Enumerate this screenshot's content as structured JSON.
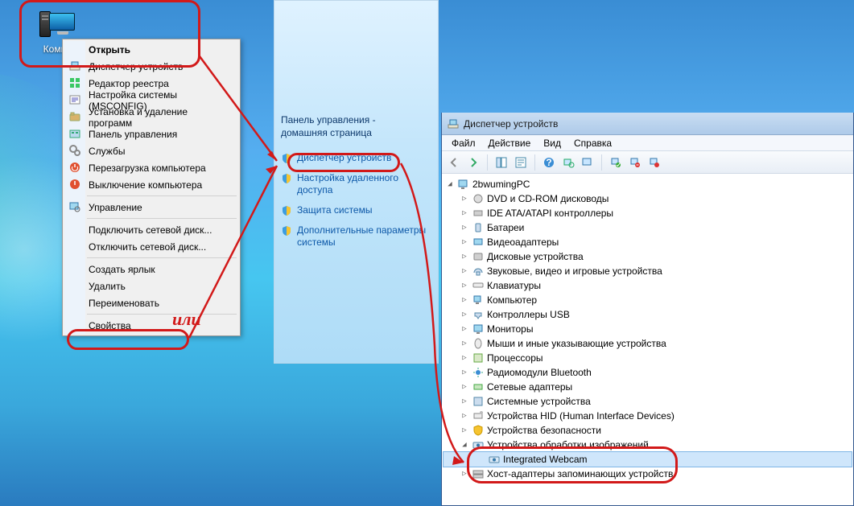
{
  "desktop_icon_label": "Компь",
  "context_menu": {
    "open": "Открыть",
    "device_manager": "Диспетчер устройств",
    "regedit": "Редактор реестра",
    "msconfig": "Настройка системы (MSCONFIG)",
    "add_remove": "Установка и удаление программ",
    "control_panel": "Панель управления",
    "services": "Службы",
    "restart": "Перезагрузка компьютера",
    "shutdown": "Выключение компьютера",
    "manage": "Управление",
    "map_drive": "Подключить сетевой диск...",
    "disconnect_drive": "Отключить сетевой диск...",
    "create_shortcut": "Создать ярлык",
    "delete": "Удалить",
    "rename": "Переименовать",
    "properties": "Свойства"
  },
  "cp": {
    "head1": "Панель управления -",
    "head2": "домашняя страница",
    "link_dm": "Диспетчер устройств",
    "link_remote1": "Настройка удаленного",
    "link_remote2": "доступа",
    "link_protect": "Защита системы",
    "link_adv1": "Дополнительные параметры",
    "link_adv2": "системы"
  },
  "dm": {
    "title": "Диспетчер устройств",
    "menu": {
      "file": "Файл",
      "action": "Действие",
      "view": "Вид",
      "help": "Справка"
    },
    "root": "2bwumingPC",
    "nodes": [
      {
        "label": "DVD и CD-ROM дисководы"
      },
      {
        "label": "IDE ATA/ATAPI контроллеры"
      },
      {
        "label": "Батареи"
      },
      {
        "label": "Видеоадаптеры"
      },
      {
        "label": "Дисковые устройства"
      },
      {
        "label": "Звуковые, видео и игровые устройства"
      },
      {
        "label": "Клавиатуры"
      },
      {
        "label": "Компьютер"
      },
      {
        "label": "Контроллеры USB"
      },
      {
        "label": "Мониторы"
      },
      {
        "label": "Мыши и иные указывающие устройства"
      },
      {
        "label": "Процессоры"
      },
      {
        "label": "Радиомодули Bluetooth"
      },
      {
        "label": "Сетевые адаптеры"
      },
      {
        "label": "Системные устройства"
      },
      {
        "label": "Устройства HID (Human Interface Devices)"
      },
      {
        "label": "Устройства безопасности"
      }
    ],
    "imaging": "Устройства обработки изображений",
    "webcam": "Integrated Webcam",
    "host_adapters": "Хост-адаптеры запоминающих устройств"
  },
  "annotation_or": "или"
}
